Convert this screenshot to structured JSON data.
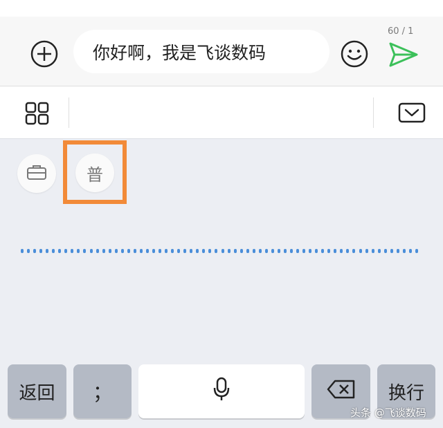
{
  "compose": {
    "input_text": "你好啊，我是飞谈数码",
    "counter": "60 / 1",
    "plus_icon": "plus-circle-icon",
    "emoji_icon": "smiley-icon",
    "send_icon": "send-icon",
    "send_color": "#3cc05a"
  },
  "toolbar": {
    "grid_icon": "grid-icon",
    "collapse_icon": "chevron-down-icon"
  },
  "keyboard": {
    "toolbox_icon": "briefcase-icon",
    "mode_label": "普",
    "highlight_color": "#f28a38",
    "wave_color": "#4a8ed9",
    "keys": {
      "back": "返回",
      "semicolon": "；",
      "mic_icon": "microphone-icon",
      "delete_icon": "backspace-icon",
      "enter": "换行"
    }
  },
  "watermark": "头条 @飞谈数码"
}
